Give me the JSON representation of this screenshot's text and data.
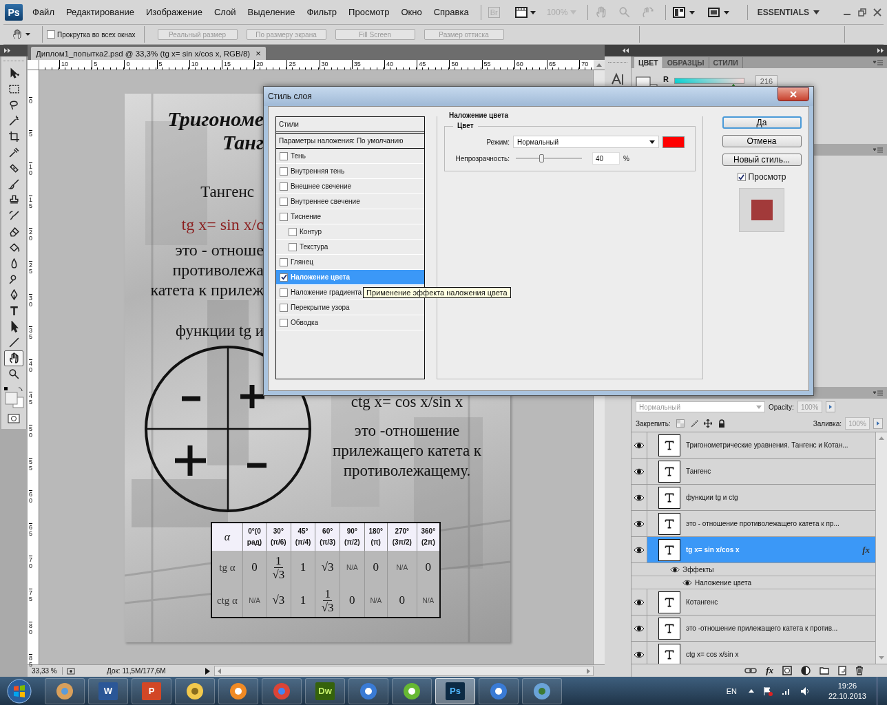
{
  "menu_bar": {
    "logo": "Ps",
    "menus": [
      "Файл",
      "Редактирование",
      "Изображение",
      "Слой",
      "Выделение",
      "Фильтр",
      "Просмотр",
      "Окно",
      "Справка"
    ],
    "bridge": "Br",
    "zoom_level": "100%",
    "workspace": "ESSENTIALS"
  },
  "options_bar": {
    "scroll_all": {
      "label": "Прокрутка во всех окнах",
      "checked": false
    },
    "buttons": [
      {
        "label": "Реальный размер",
        "disabled": true
      },
      {
        "label": "По размеру экрана",
        "disabled": true
      },
      {
        "label": "Fill Screen",
        "disabled": true
      },
      {
        "label": "Размер оттиска",
        "disabled": true
      }
    ]
  },
  "tools": [
    {
      "kind": "move",
      "selected": false
    },
    {
      "kind": "marquee",
      "selected": false
    },
    {
      "kind": "lasso",
      "selected": false
    },
    {
      "kind": "wand",
      "selected": false
    },
    {
      "kind": "crop",
      "selected": false
    },
    {
      "kind": "eyedropper",
      "selected": false
    },
    {
      "kind": "heal",
      "selected": false
    },
    {
      "kind": "brush",
      "selected": false
    },
    {
      "kind": "stamp",
      "selected": false
    },
    {
      "kind": "history",
      "selected": false
    },
    {
      "kind": "eraser",
      "selected": false
    },
    {
      "kind": "bucket",
      "selected": false
    },
    {
      "kind": "blur",
      "selected": false
    },
    {
      "kind": "dodge",
      "selected": false
    },
    {
      "kind": "pen",
      "selected": false
    },
    {
      "kind": "type",
      "selected": false
    },
    {
      "kind": "path",
      "selected": false
    },
    {
      "kind": "line",
      "selected": false
    },
    {
      "kind": "hand",
      "selected": true
    },
    {
      "kind": "zoom",
      "selected": false
    }
  ],
  "document": {
    "tab_title": "Диплом1_попытка2.psd @ 33,3% (tg x= sin x/cos x, RGB/8)",
    "close": "×",
    "ruler_h": [
      "10",
      "5",
      "0",
      "5",
      "10",
      "15",
      "20",
      "25",
      "30",
      "35",
      "40",
      "45",
      "50",
      "55",
      "60",
      "65",
      "70"
    ],
    "ruler_v": [
      "0",
      "5",
      "10",
      "15",
      "20",
      "25",
      "30",
      "35",
      "40",
      "45",
      "50",
      "55",
      "60",
      "65",
      "70",
      "75",
      "80",
      "85"
    ],
    "poster": {
      "left_lines": [
        {
          "kind": "title",
          "text": "Тригономе"
        },
        {
          "kind": "title2",
          "text": "Танг"
        },
        {
          "kind": "heading",
          "text": "Тангенс"
        },
        {
          "kind": "formula",
          "text": "tg x= sin x/c"
        },
        {
          "kind": "body",
          "text": "это - отноше"
        },
        {
          "kind": "body",
          "text": "противолежа"
        },
        {
          "kind": "body",
          "text": "катета к прилеж"
        },
        {
          "kind": "body-gap",
          "text": "функции tg и"
        }
      ],
      "ctg_formula": "ctg x= cos x/sin x",
      "ctg_lines": [
        "это -отношение",
        "прилежащего катета к",
        "противолежащему."
      ],
      "table": {
        "header": [
          [
            "α"
          ],
          [
            "0°(0",
            "рад)"
          ],
          [
            "30°",
            "(π/6)"
          ],
          [
            "45°",
            "(π/4)"
          ],
          [
            "60°",
            "(π/3)"
          ],
          [
            "90°",
            "(π/2)"
          ],
          [
            "180°",
            "(π)"
          ],
          [
            "270°",
            "(3π/2)"
          ],
          [
            "360°",
            "(2π)"
          ]
        ],
        "rows": [
          {
            "label": "tg α",
            "cells": [
              {
                "kind": "num",
                "text": "0"
              },
              {
                "kind": "frac",
                "num": "1",
                "den": "√3"
              },
              {
                "kind": "num",
                "text": "1"
              },
              {
                "kind": "num",
                "text": "√3"
              },
              {
                "kind": "na",
                "text": "N/A"
              },
              {
                "kind": "num",
                "text": "0"
              },
              {
                "kind": "na",
                "text": "N/A"
              },
              {
                "kind": "num",
                "text": "0"
              }
            ]
          },
          {
            "label": "ctg α",
            "cells": [
              {
                "kind": "na",
                "text": "N/A"
              },
              {
                "kind": "num",
                "text": "√3"
              },
              {
                "kind": "num",
                "text": "1"
              },
              {
                "kind": "frac",
                "num": "1",
                "den": "√3"
              },
              {
                "kind": "num",
                "text": "0"
              },
              {
                "kind": "na",
                "text": "N/A"
              },
              {
                "kind": "num",
                "text": "0"
              },
              {
                "kind": "na",
                "text": "N/A"
              }
            ]
          }
        ]
      }
    },
    "status": {
      "zoom": "33,33 %",
      "doc": "Док: 11,5M/177,6M"
    }
  },
  "color_panel": {
    "tabs": [
      {
        "label": "ЦВЕТ",
        "selected": true
      },
      {
        "label": "ОБРАЗЦЫ",
        "selected": false
      },
      {
        "label": "СТИЛИ",
        "selected": false
      }
    ],
    "channel": "R",
    "level": 0.847,
    "value": "216"
  },
  "layers_panel": {
    "blend_mode": "Нормальный",
    "opacity_label": "Opacity:",
    "opacity": "100%",
    "lock_label": "Закрепить:",
    "fill_label": "Заливка:",
    "fill": "100%",
    "footer_fx": "fx",
    "items": [
      {
        "name": "Тригонометрические уравнения. Тангенс и Котан...",
        "visible": true,
        "selected": false
      },
      {
        "name": "Тангенс",
        "visible": true,
        "selected": false
      },
      {
        "name": "функции tg и ctg",
        "visible": true,
        "selected": false
      },
      {
        "name": "это - отношение противолежащего  катета к пр...",
        "visible": true,
        "selected": false
      },
      {
        "name": "tg x= sin x/cos x",
        "visible": true,
        "selected": true,
        "fx": "fx",
        "effects": {
          "label": "Эффекты",
          "items": [
            "Наложение цвета"
          ]
        }
      },
      {
        "name": "Котангенс",
        "visible": true,
        "selected": false
      },
      {
        "name": " это -отношение прилежащего катета к против...",
        "visible": true,
        "selected": false
      },
      {
        "name": "ctg x= cos x/sin x",
        "visible": true,
        "selected": false
      }
    ]
  },
  "dialog": {
    "title": "Стиль слоя",
    "styles_header": "Стили",
    "blending": "Параметры наложения: По умолчанию",
    "items": [
      {
        "label": "Тень",
        "checked": false,
        "selected": false
      },
      {
        "label": "Внутренняя тень",
        "checked": false,
        "selected": false
      },
      {
        "label": "Внешнее свечение",
        "checked": false,
        "selected": false
      },
      {
        "label": "Внутреннее свечение",
        "checked": false,
        "selected": false
      },
      {
        "label": "Тиснение",
        "checked": false,
        "selected": false,
        "children": [
          {
            "label": "Контур",
            "checked": false,
            "selected": false
          },
          {
            "label": "Текстура",
            "checked": false,
            "selected": false
          }
        ]
      },
      {
        "label": "Глянец",
        "checked": false,
        "selected": false
      },
      {
        "label": "Наложение цвета",
        "checked": true,
        "selected": true
      },
      {
        "label": "Наложение градиента",
        "checked": false,
        "selected": false
      },
      {
        "label": "Перекрытие узора",
        "checked": false,
        "selected": false
      },
      {
        "label": "Обводка",
        "checked": false,
        "selected": false
      }
    ],
    "tooltip": "Применение эффекта наложения цвета",
    "section": "Наложение цвета",
    "group": "Цвет",
    "mode_label": "Режим:",
    "mode": "Нормальный",
    "color": "#ff0000",
    "opacity_label": "Непрозрачность:",
    "opacity_slider": {
      "level": 0.4
    },
    "opacity": "40",
    "percent": "%",
    "buttons": [
      {
        "label": "Да",
        "default": true
      },
      {
        "label": "Отмена",
        "default": false
      },
      {
        "label": "Новый стиль...",
        "default": false
      }
    ],
    "preview": {
      "label": "Просмотр",
      "checked": true
    }
  },
  "taskbar": {
    "items": [
      {
        "kind": "paint",
        "selected": false
      },
      {
        "kind": "word",
        "label": "W",
        "selected": false
      },
      {
        "kind": "powerpoint",
        "label": "P",
        "selected": false
      },
      {
        "kind": "explorer",
        "selected": false
      },
      {
        "kind": "media",
        "selected": false
      },
      {
        "kind": "chrome",
        "selected": false
      },
      {
        "kind": "dreamweaver",
        "label": "Dw",
        "selected": false
      },
      {
        "kind": "itunes",
        "selected": false
      },
      {
        "kind": "utorrent",
        "selected": false
      },
      {
        "kind": "photoshop",
        "label": "Ps",
        "selected": true
      },
      {
        "kind": "itunes",
        "selected": false
      },
      {
        "kind": "photos",
        "selected": false
      }
    ],
    "language": "EN",
    "time": "19:26",
    "date": "22.10.2013"
  }
}
